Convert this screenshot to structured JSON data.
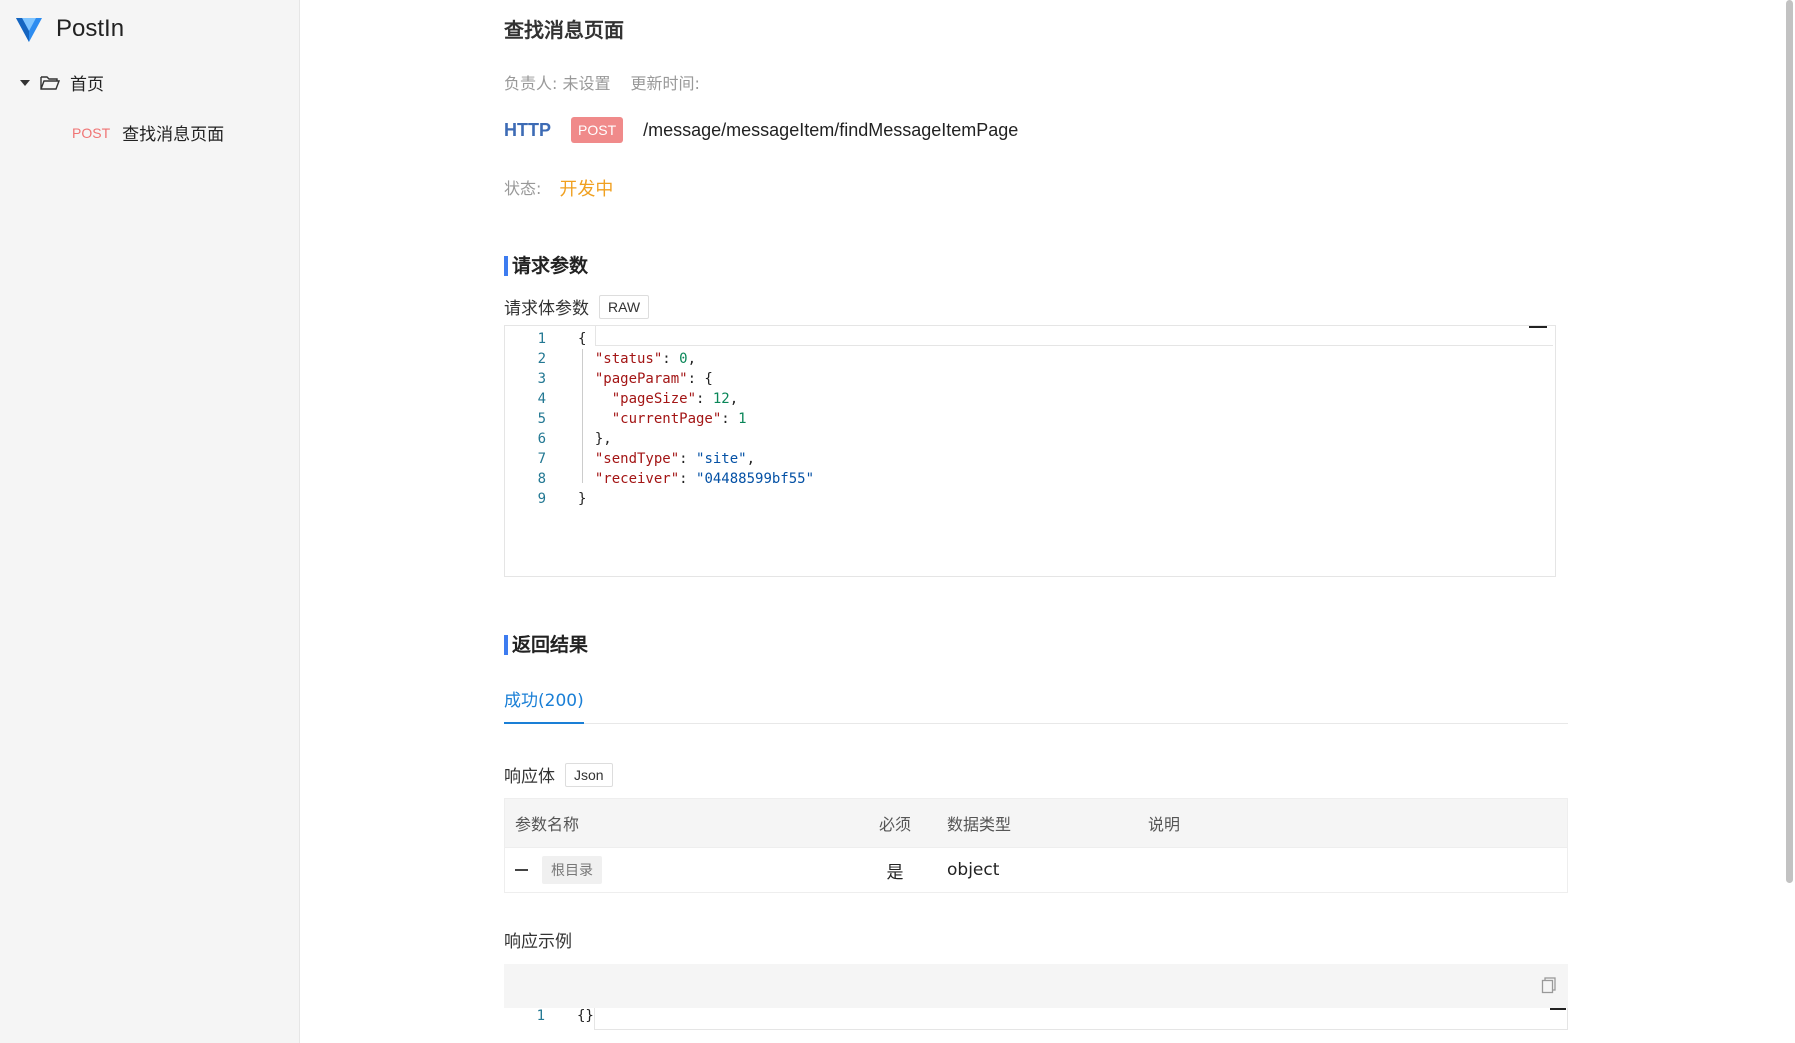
{
  "app": {
    "name": "PostIn"
  },
  "sidebar": {
    "home_label": "首页",
    "api_item": {
      "method": "POST",
      "name": "查找消息页面"
    }
  },
  "api": {
    "title": "查找消息页面",
    "owner_label": "负责人: 未设置",
    "updated_label": "更新时间:",
    "protocol": "HTTP",
    "method": "POST",
    "path": "/message/messageItem/findMessageItemPage",
    "status_label": "状态:",
    "status_value": "开发中"
  },
  "request": {
    "section_title": "请求参数",
    "body_label": "请求体参数",
    "body_type": "RAW",
    "code_lines": [
      {
        "n": "1",
        "indent": "",
        "parts": [
          [
            "p",
            "{"
          ]
        ]
      },
      {
        "n": "2",
        "indent": "  ",
        "parts": [
          [
            "k",
            "\"status\""
          ],
          [
            "p",
            ": "
          ],
          [
            "n",
            "0"
          ],
          [
            "p",
            ","
          ]
        ]
      },
      {
        "n": "3",
        "indent": "  ",
        "parts": [
          [
            "k",
            "\"pageParam\""
          ],
          [
            "p",
            ": {"
          ]
        ]
      },
      {
        "n": "4",
        "indent": "    ",
        "parts": [
          [
            "k",
            "\"pageSize\""
          ],
          [
            "p",
            ": "
          ],
          [
            "n",
            "12"
          ],
          [
            "p",
            ","
          ]
        ]
      },
      {
        "n": "5",
        "indent": "    ",
        "parts": [
          [
            "k",
            "\"currentPage\""
          ],
          [
            "p",
            ": "
          ],
          [
            "n",
            "1"
          ]
        ]
      },
      {
        "n": "6",
        "indent": "  ",
        "parts": [
          [
            "p",
            "},"
          ]
        ]
      },
      {
        "n": "7",
        "indent": "  ",
        "parts": [
          [
            "k",
            "\"sendType\""
          ],
          [
            "p",
            ": "
          ],
          [
            "s",
            "\"site\""
          ],
          [
            "p",
            ","
          ]
        ]
      },
      {
        "n": "8",
        "indent": "  ",
        "parts": [
          [
            "k",
            "\"receiver\""
          ],
          [
            "p",
            ": "
          ],
          [
            "s",
            "\"04488599bf55\""
          ]
        ]
      },
      {
        "n": "9",
        "indent": "",
        "parts": [
          [
            "p",
            "}"
          ]
        ]
      }
    ]
  },
  "response": {
    "section_title": "返回结果",
    "tab_label": "成功(200)",
    "body_label": "响应体",
    "body_type": "Json",
    "table": {
      "headers": [
        "参数名称",
        "必须",
        "数据类型",
        "说明"
      ],
      "rows": [
        {
          "name": "根目录",
          "required": "是",
          "type": "object",
          "desc": ""
        }
      ]
    },
    "example_label": "响应示例",
    "example_line": {
      "n": "1",
      "text": "{}"
    }
  }
}
